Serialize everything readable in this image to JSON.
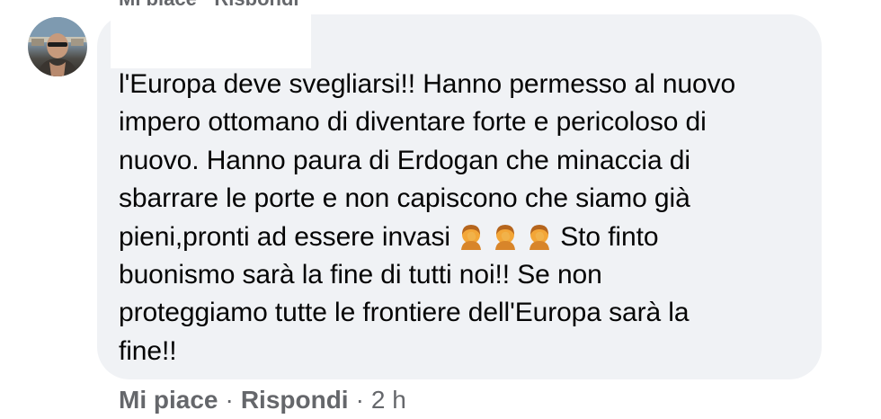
{
  "comment": {
    "text_lines": [
      "l'Europa deve svegliarsi!! Hanno permesso al nuovo",
      "impero ottomano di diventare forte e pericoloso di",
      "nuovo. Hanno paura di Erdogan che minaccia di",
      "sbarrare le porte e non capiscono che siamo già",
      "pieni,pronti ad essere invasi",
      "Sto finto",
      "buonismo sarà la fine di tutti noi!! Se non",
      "proteggiamo tutte le frontiere dell'Europa sarà la",
      "fine!!"
    ],
    "emojis": [
      "facepalm-emoji",
      "facepalm-emoji",
      "facepalm-emoji"
    ]
  },
  "actions": {
    "like": "Mi piace",
    "separator": "·",
    "reply": "Rispondi",
    "time": "2 h"
  },
  "colors": {
    "bubble": "#f0f2f5",
    "text": "#050505",
    "secondary": "#65676b"
  }
}
